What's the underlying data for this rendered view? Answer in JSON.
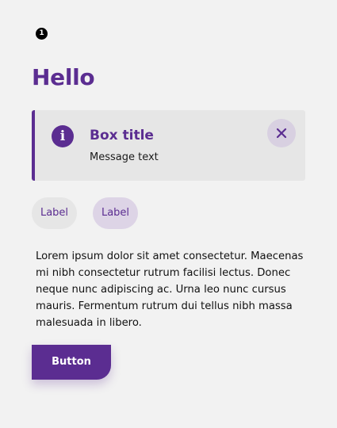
{
  "step": {
    "number": "1"
  },
  "page": {
    "title": "Hello"
  },
  "notification": {
    "title": "Box title",
    "message": "Message text",
    "icon": "info-icon",
    "close_icon": "close-icon",
    "accent_color": "#5b2d91"
  },
  "chips": [
    {
      "label": "Label",
      "selected": false
    },
    {
      "label": "Label",
      "selected": true
    }
  ],
  "content": {
    "paragraph": "Lorem ipsum dolor sit amet consectetur. Maecenas mi nibh consectetur rutrum facilisi lectus. Donec neque nunc adipiscing ac. Urna leo nunc cursus mauris. Fermentum rutrum dui tellus nibh massa malesuada in libero."
  },
  "actions": {
    "primary_label": "Button"
  },
  "theme": {
    "brand": "#5b2d91",
    "background": "#f2f2f2",
    "surface": "#e6e6e6",
    "chip_selected": "#ddd4e6"
  }
}
